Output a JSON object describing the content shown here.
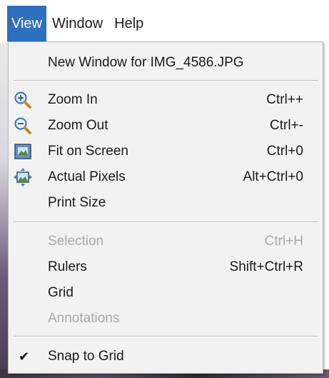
{
  "menubar": {
    "items": [
      {
        "label": "View",
        "active": true
      },
      {
        "label": "Window",
        "active": false
      },
      {
        "label": "Help",
        "active": false
      }
    ]
  },
  "menu": {
    "new_window": {
      "label": "New Window for IMG_4586.JPG"
    },
    "zoom_in": {
      "label": "Zoom In",
      "shortcut": "Ctrl++",
      "icon": "zoom-in-icon"
    },
    "zoom_out": {
      "label": "Zoom Out",
      "shortcut": "Ctrl+-",
      "icon": "zoom-out-icon"
    },
    "fit_on_screen": {
      "label": "Fit on Screen",
      "shortcut": "Ctrl+0",
      "icon": "fit-on-screen-icon"
    },
    "actual_pixels": {
      "label": "Actual Pixels",
      "shortcut": "Alt+Ctrl+0",
      "icon": "actual-pixels-icon"
    },
    "print_size": {
      "label": "Print Size"
    },
    "selection": {
      "label": "Selection",
      "shortcut": "Ctrl+H",
      "disabled": true
    },
    "rulers": {
      "label": "Rulers",
      "shortcut": "Shift+Ctrl+R"
    },
    "grid": {
      "label": "Grid"
    },
    "annotations": {
      "label": "Annotations",
      "disabled": true
    },
    "snap_to_grid": {
      "label": "Snap to Grid",
      "checked": true,
      "check_glyph": "✔"
    }
  },
  "colors": {
    "menubar_active": "#2f6fc0",
    "menu_bg": "#f2f2f2",
    "disabled_text": "#a9a9a9"
  }
}
